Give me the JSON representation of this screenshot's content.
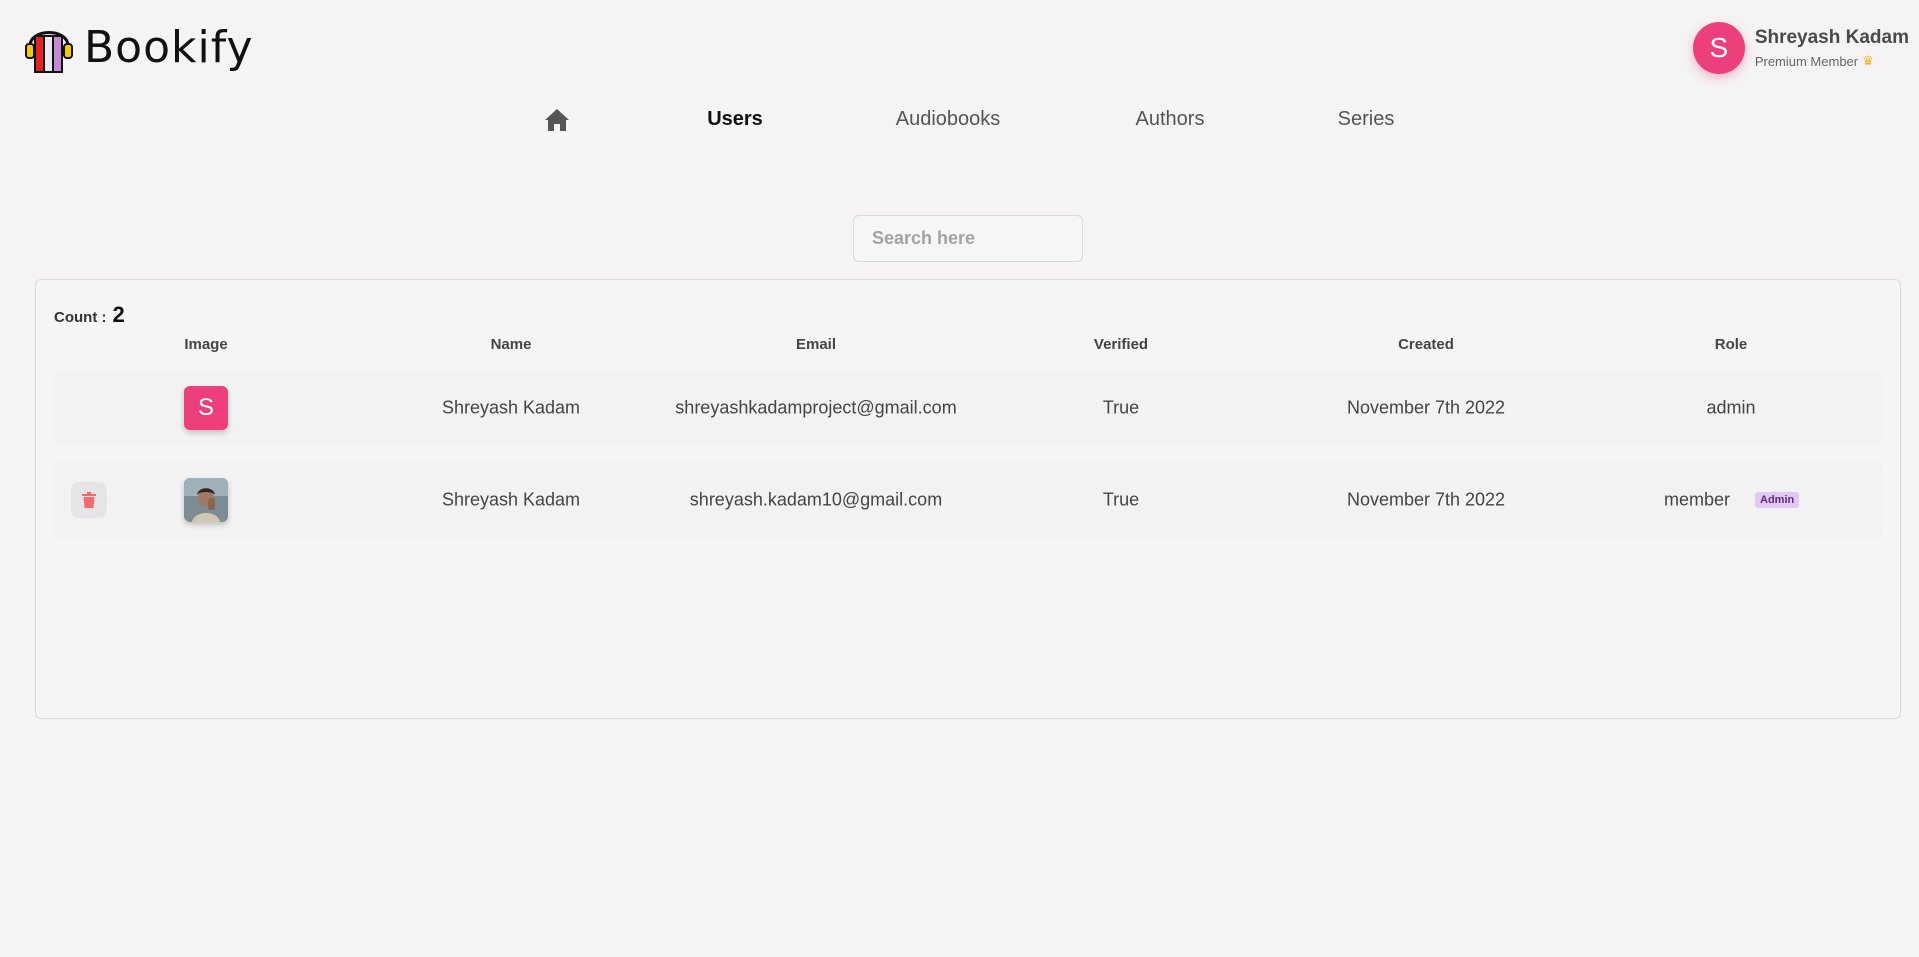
{
  "brand": {
    "name": "Bookify"
  },
  "profile": {
    "initial": "S",
    "name": "Shreyash Kadam",
    "membership": "Premium Member"
  },
  "nav": {
    "home_icon": "home-icon",
    "items": [
      {
        "label": "Users",
        "active": true
      },
      {
        "label": "Audiobooks",
        "active": false
      },
      {
        "label": "Authors",
        "active": false
      },
      {
        "label": "Series",
        "active": false
      }
    ]
  },
  "search": {
    "placeholder": "Search here",
    "value": ""
  },
  "table": {
    "count_label": "Count :",
    "count_value": "2",
    "headers": [
      "Image",
      "Name",
      "Email",
      "Verified",
      "Created",
      "Role"
    ],
    "rows": [
      {
        "image": "avatar-initial",
        "initial": "S",
        "name": "Shreyash Kadam",
        "email": "shreyashkadamproject@gmail.com",
        "verified": "True",
        "created": "November 7th 2022",
        "role": "admin"
      },
      {
        "image": "avatar-photo",
        "name": "Shreyash Kadam",
        "email": "shreyash.kadam10@gmail.com",
        "verified": "True",
        "created": "November 7th 2022",
        "role": "member",
        "make_admin_label": "Admin",
        "delete_icon": "trash-icon"
      }
    ]
  },
  "colors": {
    "accent": "#ec3f7b",
    "badge": "#e3c9f2",
    "delete": "#f36b6b"
  }
}
